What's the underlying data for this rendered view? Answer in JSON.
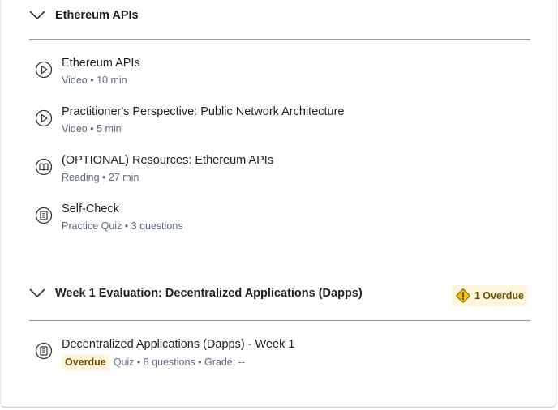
{
  "sections": [
    {
      "title": "Ethereum APIs",
      "items": [
        {
          "title": "Ethereum APIs",
          "meta": "Video • 10 min",
          "icon": "play-circle-icon"
        },
        {
          "title": "Practitioner's Perspective: Public Network Architecture",
          "meta": "Video • 5 min",
          "icon": "play-circle-icon"
        },
        {
          "title": "(OPTIONAL) Resources: Ethereum APIs",
          "meta": "Reading • 27 min",
          "icon": "book-icon"
        },
        {
          "title": "Self-Check",
          "meta": "Practice Quiz • 3 questions",
          "icon": "quiz-icon"
        }
      ]
    },
    {
      "title": "Week 1 Evaluation: Decentralized Applications (Dapps)",
      "overdue_badge": "1 Overdue",
      "items": [
        {
          "title": "Decentralized Applications (Dapps) - Week 1",
          "status": "Overdue",
          "meta": "Quiz • 8 questions • Grade: --",
          "icon": "quiz-icon"
        }
      ]
    }
  ],
  "colors": {
    "overdue_bg": "#fdf5dc",
    "overdue_text": "#6e5200",
    "warning_icon": "#f2c200",
    "meta_text": "#5b6780"
  }
}
